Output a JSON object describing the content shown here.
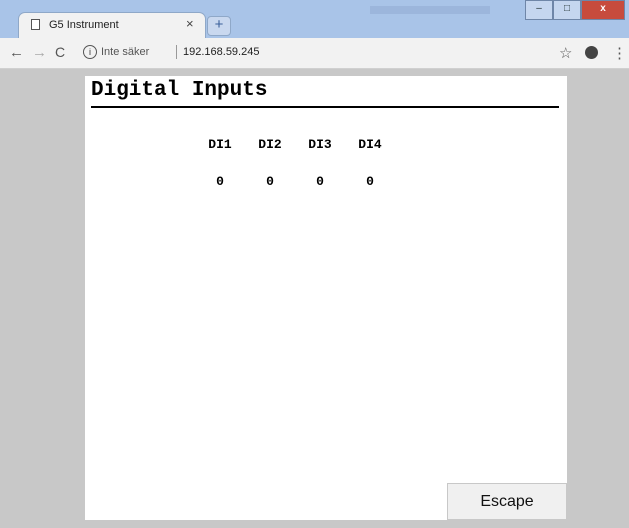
{
  "browser": {
    "tab": {
      "title": "G5 Instrument",
      "close": "×"
    },
    "new_tab": "+",
    "window_buttons": {
      "minimize": "–",
      "maximize": "□",
      "close": "x"
    },
    "nav": {
      "back": "←",
      "forward": "→",
      "reload": "C"
    },
    "omnibox": {
      "info": "i",
      "security_label": "Inte säker",
      "url": "192.168.59.245"
    },
    "star": "☆",
    "menu": "⋮"
  },
  "page": {
    "title": "Digital Inputs",
    "inputs": [
      {
        "label": "DI1",
        "value": "0"
      },
      {
        "label": "DI2",
        "value": "0"
      },
      {
        "label": "DI3",
        "value": "0"
      },
      {
        "label": "DI4",
        "value": "0"
      }
    ],
    "escape_label": "Escape"
  }
}
